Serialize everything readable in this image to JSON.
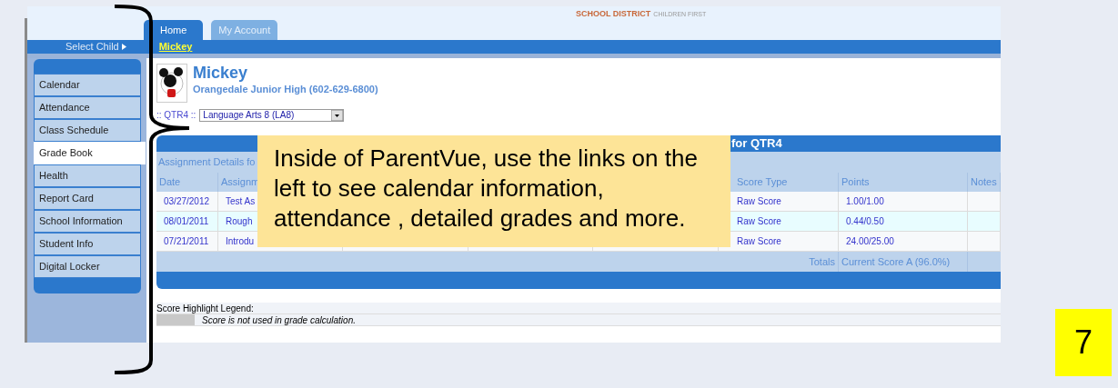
{
  "logo": {
    "name": "SCHOOL DISTRICT",
    "tagline": "CHILDREN FIRST"
  },
  "tabs": [
    {
      "label": "Home",
      "selected": true
    },
    {
      "label": "My Account",
      "selected": false
    }
  ],
  "child_bar": {
    "label": "Select Child",
    "child": "Mickey"
  },
  "sidebar": {
    "items": [
      {
        "label": "Calendar",
        "selected": false
      },
      {
        "label": "Attendance",
        "selected": false
      },
      {
        "label": "Class Schedule",
        "selected": false
      },
      {
        "label": "Grade Book",
        "selected": true
      },
      {
        "label": "Health",
        "selected": false
      },
      {
        "label": "Report Card",
        "selected": false
      },
      {
        "label": "School Information",
        "selected": false
      },
      {
        "label": "Student Info",
        "selected": false
      },
      {
        "label": "Digital Locker",
        "selected": false
      }
    ]
  },
  "student": {
    "name": "Mickey",
    "school": "Orangedale Junior High (602-629-6800)"
  },
  "filter": {
    "period": ":: QTR4 ::",
    "course": "Language Arts 8 (LA8)"
  },
  "gradebook": {
    "title": "for QTR4",
    "subtitle": "Assignment Details fo",
    "columns": {
      "date": "Date",
      "assignment": "Assignm",
      "score_type": "Score Type",
      "points": "Points",
      "notes": "Notes"
    },
    "rows": [
      {
        "date": "03/27/2012",
        "assignment": "Test As",
        "score_type": "Raw Score",
        "points": "1.00/1.00"
      },
      {
        "date": "08/01/2011",
        "assignment": "Rough",
        "score_type": "Raw Score",
        "points": "0.44/0.50"
      },
      {
        "date": "07/21/2011",
        "assignment": "Introdu",
        "score_type": "Raw Score",
        "points": "24.00/25.00"
      }
    ],
    "totals": {
      "label": "Totals",
      "value": "Current Score A (96.0%)"
    }
  },
  "legend": {
    "title": "Score Highlight Legend:",
    "items": [
      "Score is not used in grade calculation."
    ]
  },
  "callout": {
    "text": "Inside of ParentVue, use the links on the left to see calendar information, attendance , detailed grades and more."
  },
  "slide_number": "7"
}
